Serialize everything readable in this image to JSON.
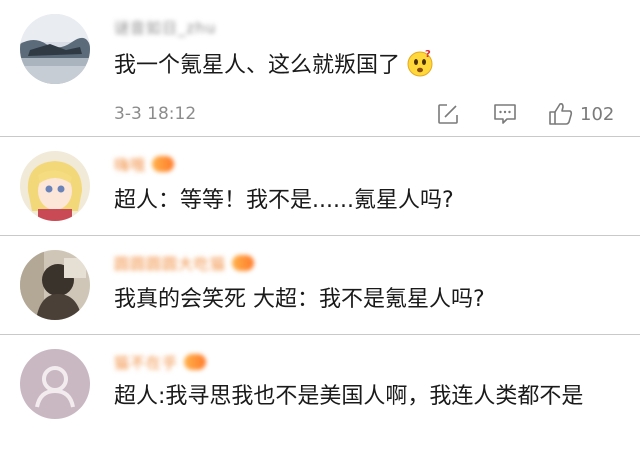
{
  "comments": [
    {
      "username": "谜音如日_zhu",
      "text": "我一个氪星人、这么就叛国了",
      "emoji": "thinking-face-emoji",
      "time": "3-3 18:12",
      "like_count": "102"
    },
    {
      "username": "嗨哦",
      "text": "超人：等等！我不是......氪星人吗?"
    },
    {
      "username": "圆圆圆圆大吃猫",
      "text": "我真的会笑死 大超：我不是氪星人吗?"
    },
    {
      "username": "猫不在乎",
      "text": "超人:我寻思我也不是美国人啊，我连人类都不是"
    }
  ],
  "icons": {
    "repost": "edit-square-icon",
    "comment": "comment-icon",
    "like": "thumbs-up-icon"
  },
  "colors": {
    "meta_gray": "#8c8c8c",
    "vip_orange": "#f08a3a",
    "divider": "#c9c9c9"
  }
}
